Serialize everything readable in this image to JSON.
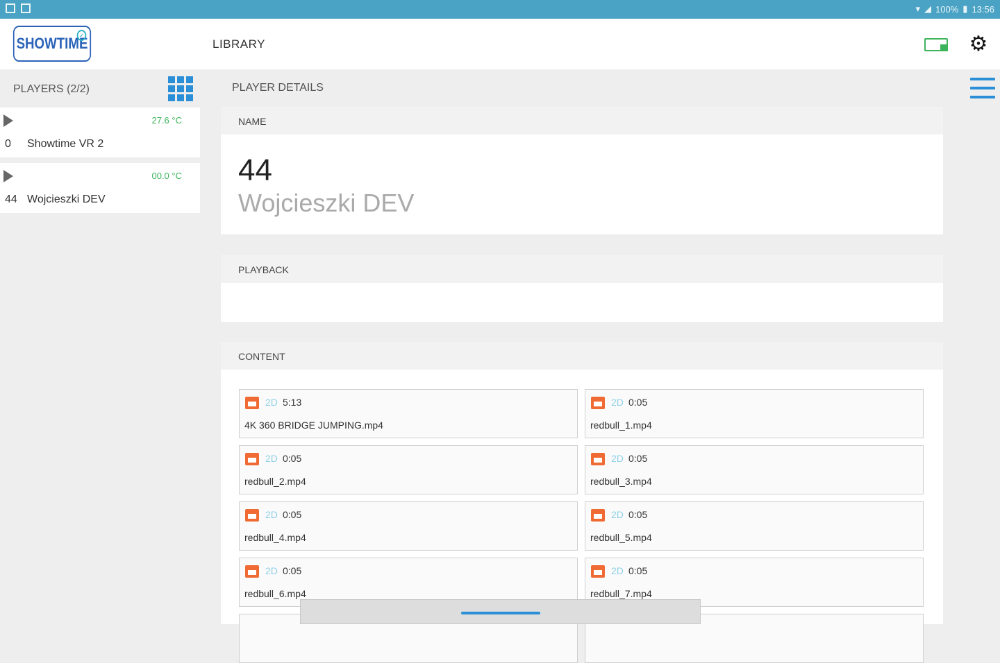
{
  "status_bar": {
    "battery": "100%",
    "time": "13:56"
  },
  "app": {
    "logo_text": "SHOWTIME",
    "title": "LIBRARY"
  },
  "sidebar": {
    "heading": "PLAYERS (2/2)",
    "players": [
      {
        "temp": "27.6 °C",
        "id": "0",
        "name": "Showtime VR 2"
      },
      {
        "temp": "00.0 °C",
        "id": "44",
        "name": "Wojcieszki DEV"
      }
    ]
  },
  "main": {
    "heading": "PLAYER DETAILS",
    "name_card": {
      "label": "NAME",
      "number": "44",
      "name": "Wojcieszki DEV"
    },
    "playback_card": {
      "label": "PLAYBACK"
    },
    "content_card": {
      "label": "CONTENT",
      "items": [
        {
          "dim": "2D",
          "duration": "5:13",
          "file": "4K 360 BRIDGE JUMPING.mp4"
        },
        {
          "dim": "2D",
          "duration": "0:05",
          "file": "redbull_1.mp4"
        },
        {
          "dim": "2D",
          "duration": "0:05",
          "file": "redbull_2.mp4"
        },
        {
          "dim": "2D",
          "duration": "0:05",
          "file": "redbull_3.mp4"
        },
        {
          "dim": "2D",
          "duration": "0:05",
          "file": "redbull_4.mp4"
        },
        {
          "dim": "2D",
          "duration": "0:05",
          "file": "redbull_5.mp4"
        },
        {
          "dim": "2D",
          "duration": "0:05",
          "file": "redbull_6.mp4"
        },
        {
          "dim": "2D",
          "duration": "0:05",
          "file": "redbull_7.mp4"
        }
      ]
    }
  },
  "colors": {
    "status_bar": "#4aa3c4",
    "accent": "#2a8fd6",
    "temp_ok": "#3db35c",
    "film": "#f06a33"
  }
}
